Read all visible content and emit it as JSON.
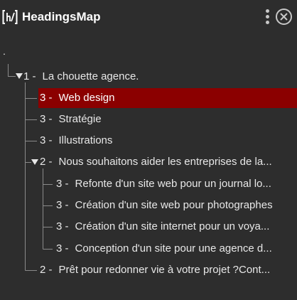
{
  "header": {
    "title": "HeadingsMap",
    "logo_text": "[h]",
    "menu_icon": "kebab-menu-icon",
    "close_icon": "close-circle-icon"
  },
  "tree": {
    "root_label": ".",
    "items": [
      {
        "level": "1 -",
        "text": "La chouette agence."
      },
      {
        "level": "3 -",
        "text": "Web design"
      },
      {
        "level": "3 -",
        "text": "Stratégie"
      },
      {
        "level": "3 -",
        "text": "Illustrations"
      },
      {
        "level": "2 -",
        "text": "Nous souhaitons aider les entreprises de la..."
      },
      {
        "level": "3 -",
        "text": "Refonte d'un site web pour un journal lo..."
      },
      {
        "level": "3 -",
        "text": "Création d'un site web pour photographes"
      },
      {
        "level": "3 -",
        "text": "Création d'un site internet pour un voya..."
      },
      {
        "level": "3 -",
        "text": "Conception d'un site pour une agence d..."
      },
      {
        "level": "2 -",
        "text": "Prêt pour redonner vie à votre projet ?Cont..."
      }
    ]
  },
  "colors": {
    "background": "#2d2d2d",
    "selected": "#8b0000",
    "text": "#e8e8e8"
  }
}
